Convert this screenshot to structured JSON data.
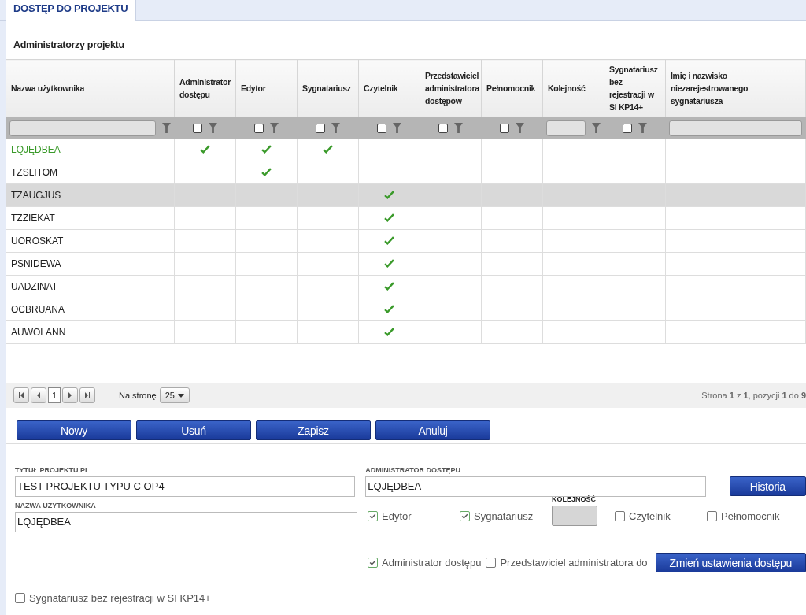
{
  "tab": {
    "label": "DOSTĘP DO PROJEKTU",
    "selected": true
  },
  "section_title": "Administratorzy projektu",
  "table": {
    "columns": [
      "Nazwa użytkownika",
      "Administrator dostępu",
      "Edytor",
      "Sygnatariusz",
      "Czytelnik",
      "Przedstawiciel administratora dostępów",
      "Pełnomocnik",
      "Kolejność",
      "Sygnatariusz bez rejestracji w SI KP14+",
      "Imię i nazwisko niezarejestrowanego sygnatariusza"
    ],
    "filters": [
      {
        "kind": "text"
      },
      {
        "kind": "checkbox",
        "checked": false
      },
      {
        "kind": "checkbox",
        "checked": false
      },
      {
        "kind": "checkbox",
        "checked": false
      },
      {
        "kind": "checkbox",
        "checked": false
      },
      {
        "kind": "checkbox",
        "checked": false
      },
      {
        "kind": "checkbox",
        "checked": false
      },
      {
        "kind": "text"
      },
      {
        "kind": "checkbox",
        "checked": false
      },
      {
        "kind": "text"
      }
    ],
    "rows": [
      {
        "name": "LQJĘDBEA",
        "current": true,
        "selected": false,
        "admin": true,
        "editor": true,
        "signatory": true,
        "reader": false
      },
      {
        "name": "TZSLITOM",
        "current": false,
        "selected": false,
        "admin": false,
        "editor": true,
        "signatory": false,
        "reader": false
      },
      {
        "name": "TZAUGJUS",
        "current": false,
        "selected": true,
        "admin": false,
        "editor": false,
        "signatory": false,
        "reader": true
      },
      {
        "name": "TZZIEKAT",
        "current": false,
        "selected": false,
        "admin": false,
        "editor": false,
        "signatory": false,
        "reader": true
      },
      {
        "name": "UOROSKAT",
        "current": false,
        "selected": false,
        "admin": false,
        "editor": false,
        "signatory": false,
        "reader": true
      },
      {
        "name": "PSNIDEWA",
        "current": false,
        "selected": false,
        "admin": false,
        "editor": false,
        "signatory": false,
        "reader": true
      },
      {
        "name": "UADZINAT",
        "current": false,
        "selected": false,
        "admin": false,
        "editor": false,
        "signatory": false,
        "reader": true
      },
      {
        "name": "OCBRUANA",
        "current": false,
        "selected": false,
        "admin": false,
        "editor": false,
        "signatory": false,
        "reader": true
      },
      {
        "name": "AUWOLANN",
        "current": false,
        "selected": false,
        "admin": false,
        "editor": false,
        "signatory": false,
        "reader": true
      }
    ]
  },
  "pager": {
    "page": "1",
    "per_page_label": "Na stronę",
    "per_page": "25",
    "summary": "Strona **1** z **1**, pozycji **1** do **9**"
  },
  "actions": [
    "Nowy",
    "Usuń",
    "Zapisz",
    "Anuluj"
  ],
  "form": {
    "title_label": "TYTUŁ PROJEKTU PL",
    "title_value": "TEST PROJEKTU TYPU C OP4",
    "admin_label": "ADMINISTRATOR DOSTĘPU",
    "admin_value": "LQJĘDBEA",
    "history_button": "Historia",
    "user_label": "NAZWA UŻYTKOWNIKA",
    "user_value": "LQJĘDBEA",
    "order_label": "KOLEJNOŚĆ",
    "roles": [
      {
        "label": "Edytor",
        "checked": true
      },
      {
        "label": "Sygnatariusz",
        "checked": true
      },
      {
        "label": "Czytelnik",
        "checked": false
      },
      {
        "label": "Pełnomocnik",
        "checked": false
      }
    ],
    "access": [
      {
        "label": "Administrator dostępu",
        "checked": true
      },
      {
        "label": "Przedstawiciel administratora do",
        "checked": false
      }
    ],
    "change_button": "Zmień ustawienia dostępu",
    "unregistered": {
      "label": "Sygnatariusz bez rejestracji w SI KP14+",
      "checked": false
    }
  }
}
